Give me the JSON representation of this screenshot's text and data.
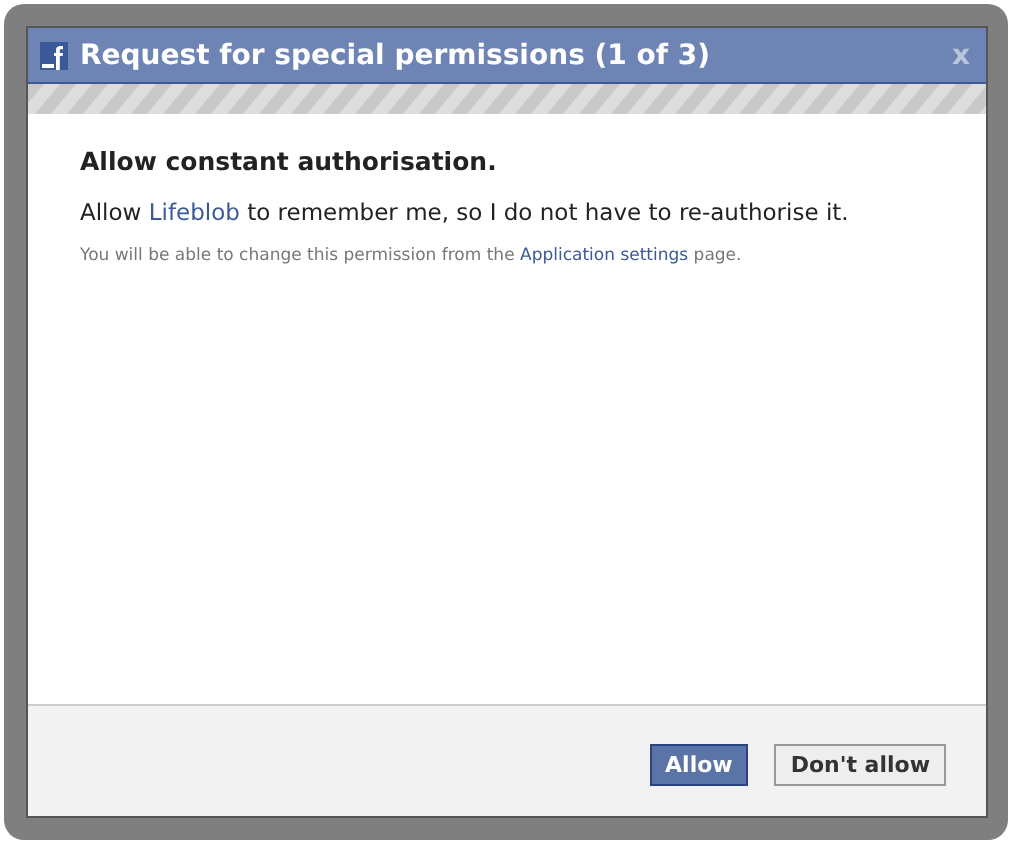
{
  "dialog": {
    "title": "Request for special permissions (1 of 3)",
    "close": "x"
  },
  "permission": {
    "heading": "Allow constant authorisation.",
    "description": {
      "before": "Allow ",
      "link": "Lifeblob",
      "after": " to remember me, so I do not have to re-authorise it."
    },
    "note": {
      "before": "You will be able to change this permission from the ",
      "link": "Application settings",
      "after": " page."
    }
  },
  "buttons": [
    {
      "label": "Allow",
      "kind": "primary"
    },
    {
      "label": "Don't allow",
      "kind": "secondary"
    }
  ]
}
